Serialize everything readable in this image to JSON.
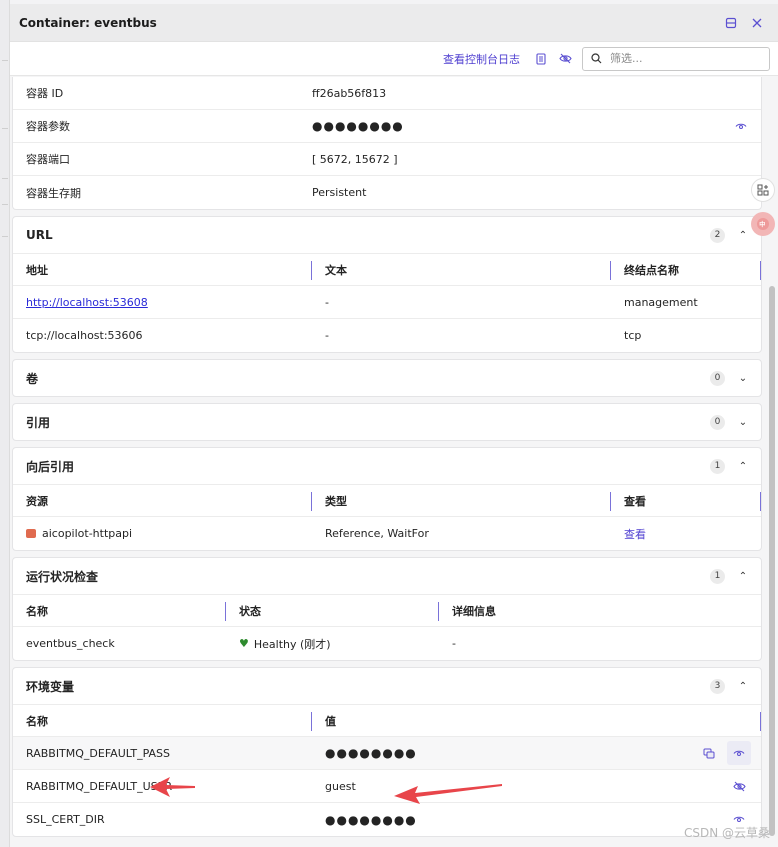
{
  "header": {
    "title": "Container: eventbus"
  },
  "toolbar": {
    "console_label": "查看控制台日志",
    "filter_placeholder": "筛选..."
  },
  "props": [
    {
      "key": "容器 ID",
      "value": "ff26ab56f813"
    },
    {
      "key": "容器参数",
      "value": "●●●●●●●●"
    },
    {
      "key": "容器端口",
      "value": "[ 5672, 15672 ]"
    },
    {
      "key": "容器生存期",
      "value": "Persistent"
    }
  ],
  "url": {
    "title": "URL",
    "count": "2",
    "headers": [
      "地址",
      "文本",
      "终结点名称"
    ],
    "rows": [
      {
        "address": "http://localhost:53608",
        "text": "-",
        "endpoint": "management"
      },
      {
        "address": "tcp://localhost:53606",
        "text": "-",
        "endpoint": "tcp"
      }
    ]
  },
  "volumes": {
    "title": "卷",
    "count": "0"
  },
  "references": {
    "title": "引用",
    "count": "0"
  },
  "backrefs": {
    "title": "向后引用",
    "count": "1",
    "headers": [
      "资源",
      "类型",
      "查看"
    ],
    "rows": [
      {
        "resource": "aicopilot-httpapi",
        "type": "Reference, WaitFor",
        "view": "查看"
      }
    ]
  },
  "health": {
    "title": "运行状况检查",
    "count": "1",
    "headers": [
      "名称",
      "状态",
      "详细信息"
    ],
    "rows": [
      {
        "name": "eventbus_check",
        "status": "Healthy (刚才)",
        "details": "-"
      }
    ]
  },
  "env": {
    "title": "环境变量",
    "count": "3",
    "headers": [
      "名称",
      "值"
    ],
    "rows": [
      {
        "name": "RABBITMQ_DEFAULT_PASS",
        "value": "●●●●●●●●"
      },
      {
        "name": "RABBITMQ_DEFAULT_USER",
        "value": "guest"
      },
      {
        "name": "SSL_CERT_DIR",
        "value": "●●●●●●●●"
      }
    ]
  },
  "watermark": "CSDN @云草桑",
  "colors": {
    "accent": "#5b4fd1",
    "arrow": "#e8454a",
    "healthy": "#2e8b2e"
  }
}
